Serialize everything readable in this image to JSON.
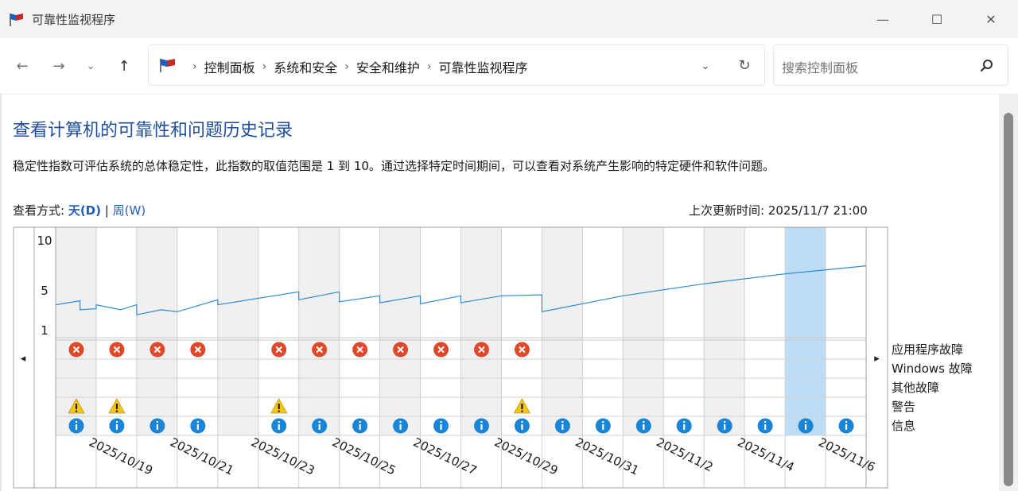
{
  "window": {
    "title": "可靠性监视程序",
    "controls": {
      "minimize": "—",
      "maximize": "☐",
      "close": "✕"
    }
  },
  "nav": {
    "back": "←",
    "forward": "→",
    "recent": "⌄",
    "up": "↑",
    "breadcrumbs": [
      "控制面板",
      "系统和安全",
      "安全和维护",
      "可靠性监视程序"
    ],
    "separator": "›",
    "dropdown": "⌄",
    "refresh": "↻"
  },
  "search": {
    "placeholder": "搜索控制面板"
  },
  "page": {
    "title": "查看计算机的可靠性和问题历史记录",
    "description": "稳定性指数可评估系统的总体稳定性，此指数的取值范围是 1 到 10。通过选择特定时间期间，可以查看对系统产生影响的特定硬件和软件问题。",
    "view_label": "查看方式: ",
    "view_day": "天(D)",
    "view_sep": " | ",
    "view_week": "周(W)",
    "last_updated_label": "上次更新时间: ",
    "last_updated_value": "2025/11/7 21:00"
  },
  "chart_data": {
    "type": "line",
    "y_ticks": [
      "10",
      "5",
      "1"
    ],
    "ylim": [
      1,
      10
    ],
    "days": [
      "2025/10/18",
      "2025/10/19",
      "2025/10/20",
      "2025/10/21",
      "2025/10/22",
      "2025/10/23",
      "2025/10/24",
      "2025/10/25",
      "2025/10/26",
      "2025/10/27",
      "2025/10/28",
      "2025/10/29",
      "2025/10/30",
      "2025/10/31",
      "2025/11/1",
      "2025/11/2",
      "2025/11/3",
      "2025/11/4",
      "2025/11/5",
      "2025/11/6"
    ],
    "x_tick_labels": [
      "2025/10/19",
      "2025/10/21",
      "2025/10/23",
      "2025/10/25",
      "2025/10/27",
      "2025/10/29",
      "2025/10/31",
      "2025/11/2",
      "2025/11/4",
      "2025/11/6"
    ],
    "selected_day": "2025/11/5",
    "stability_series": {
      "name": "稳定性指数",
      "points": [
        [
          "2025/10/18",
          3.5
        ],
        [
          "2025/10/18.6",
          3.9
        ],
        [
          "2025/10/18.6",
          3.0
        ],
        [
          "2025/10/19",
          3.1
        ],
        [
          "2025/10/19",
          3.5
        ],
        [
          "2025/10/19.6",
          3.0
        ],
        [
          "2025/10/20",
          3.5
        ],
        [
          "2025/10/20",
          2.5
        ],
        [
          "2025/10/20.6",
          3.0
        ],
        [
          "2025/10/21",
          2.8
        ],
        [
          "2025/10/22",
          4.0
        ],
        [
          "2025/10/22",
          3.5
        ],
        [
          "2025/10/24",
          4.8
        ],
        [
          "2025/10/24",
          4.0
        ],
        [
          "2025/10/25",
          4.8
        ],
        [
          "2025/10/25",
          3.8
        ],
        [
          "2025/10/26",
          4.4
        ],
        [
          "2025/10/26",
          3.7
        ],
        [
          "2025/10/27",
          4.4
        ],
        [
          "2025/10/27",
          3.6
        ],
        [
          "2025/10/28",
          4.4
        ],
        [
          "2025/10/28",
          3.7
        ],
        [
          "2025/10/29",
          4.4
        ],
        [
          "2025/10/30",
          4.5
        ],
        [
          "2025/10/30",
          2.8
        ],
        [
          "2025/11/1",
          4.4
        ],
        [
          "2025/11/3",
          5.6
        ],
        [
          "2025/11/5",
          6.6
        ],
        [
          "2025/11/7",
          7.4
        ]
      ]
    },
    "event_rows": [
      "应用程序故障",
      "Windows 故障",
      "其他故障",
      "警告",
      "信息"
    ],
    "events": {
      "应用程序故障": [
        "2025/10/18",
        "2025/10/19",
        "2025/10/20",
        "2025/10/21",
        "2025/10/23",
        "2025/10/24",
        "2025/10/25",
        "2025/10/26",
        "2025/10/27",
        "2025/10/28",
        "2025/10/29"
      ],
      "Windows 故障": [],
      "其他故障": [],
      "警告": [
        "2025/10/18",
        "2025/10/19",
        "2025/10/23",
        "2025/10/29"
      ],
      "信息": [
        "2025/10/18",
        "2025/10/19",
        "2025/10/20",
        "2025/10/21",
        "2025/10/23",
        "2025/10/24",
        "2025/10/25",
        "2025/10/26",
        "2025/10/27",
        "2025/10/28",
        "2025/10/29",
        "2025/10/30",
        "2025/10/31",
        "2025/11/1",
        "2025/11/2",
        "2025/11/3",
        "2025/11/4",
        "2025/11/5",
        "2025/11/6"
      ]
    },
    "icons": {
      "error": "error-icon",
      "warning": "warning-icon",
      "info": "info-icon"
    },
    "colors": {
      "line": "#2f8ad8",
      "error": "#e0482a",
      "warning": "#f5c518",
      "info": "#1a84d6",
      "selected": "#bddcf5",
      "shade": "#f0f0f0"
    },
    "nav": {
      "prev": "◂",
      "next": "▸"
    }
  }
}
